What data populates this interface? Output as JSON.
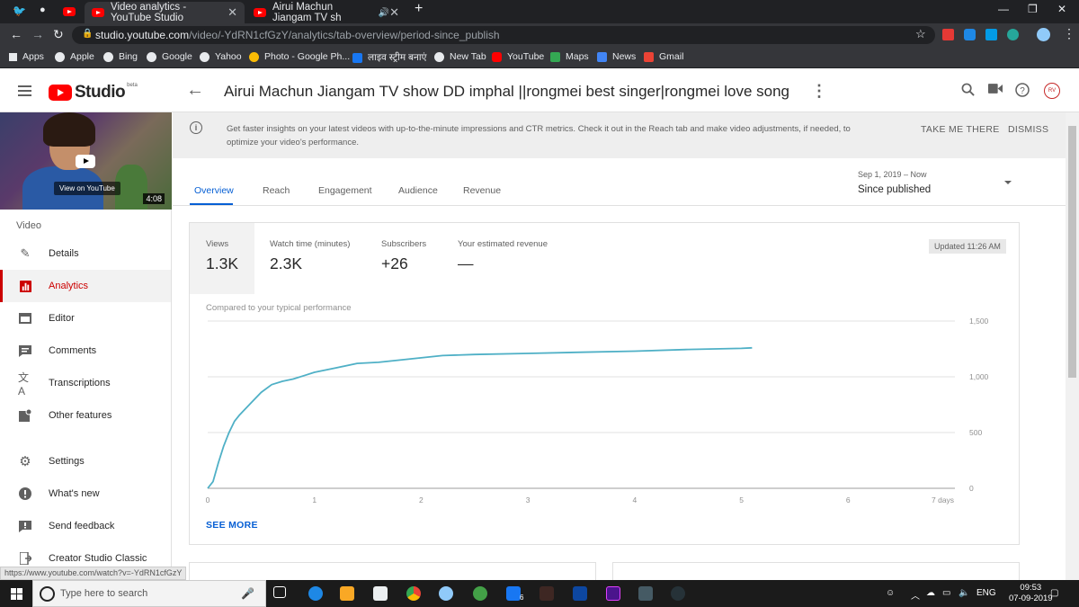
{
  "browser": {
    "tabs": [
      {
        "title": "Video analytics - YouTube Studio"
      },
      {
        "title": "Airui Machun Jiangam TV sh"
      }
    ],
    "url_host": "studio.youtube.com",
    "url_path": "/video/-YdRN1cfGzY/analytics/tab-overview/period-since_publish",
    "bookmarks": [
      "Apps",
      "Apple",
      "Bing",
      "Google",
      "Yahoo",
      "Photo - Google Ph...",
      "लाइव स्ट्रीम बनाएं",
      "New Tab",
      "YouTube",
      "Maps",
      "News",
      "Gmail"
    ],
    "status_url": "https://www.youtube.com/watch?v=-YdRN1cfGzY"
  },
  "header": {
    "logo_text": "Studio",
    "logo_beta": "beta",
    "video_title": "Airui Machun Jiangam TV show DD imphal ||rongmei best singer|rongmei love song",
    "avatar_initials": "RV"
  },
  "sidebar": {
    "thumbnail_overlay": "View on YouTube",
    "duration": "4:08",
    "section_label": "Video",
    "items": [
      {
        "label": "Details",
        "icon": "pencil-icon"
      },
      {
        "label": "Analytics",
        "icon": "analytics-icon"
      },
      {
        "label": "Editor",
        "icon": "film-icon"
      },
      {
        "label": "Comments",
        "icon": "comment-icon"
      },
      {
        "label": "Transcriptions",
        "icon": "translate-icon"
      },
      {
        "label": "Other features",
        "icon": "features-icon"
      },
      {
        "label": "Settings",
        "icon": "gear-icon"
      },
      {
        "label": "What's new",
        "icon": "whats-new-icon"
      },
      {
        "label": "Send feedback",
        "icon": "feedback-icon"
      },
      {
        "label": "Creator Studio Classic",
        "icon": "classic-icon"
      }
    ]
  },
  "banner": {
    "message": "Get faster insights on your latest videos with up-to-the-minute impressions and CTR metrics. Check it out in the Reach tab and make video adjustments, if needed, to optimize your video's performance.",
    "take_me_there": "TAKE ME THERE",
    "dismiss": "DISMISS"
  },
  "analytics_tabs": [
    "Overview",
    "Reach",
    "Engagement",
    "Audience",
    "Revenue"
  ],
  "period": {
    "range": "Sep 1, 2019 – Now",
    "label": "Since published"
  },
  "metrics": [
    {
      "label": "Views",
      "value": "1.3K"
    },
    {
      "label": "Watch time (minutes)",
      "value": "2.3K"
    },
    {
      "label": "Subscribers",
      "value": "+26"
    },
    {
      "label": "Your estimated revenue",
      "value": "—"
    }
  ],
  "updated": "Updated 11:26 AM",
  "compare_label": "Compared to your typical performance",
  "see_more": "SEE MORE",
  "chart_data": {
    "type": "line",
    "x_tick_labels": [
      "0",
      "1",
      "2",
      "3",
      "4",
      "5",
      "6",
      "7 days"
    ],
    "y_tick_labels": [
      "0",
      "500",
      "1,000",
      "1,500"
    ],
    "xlim": [
      0,
      7
    ],
    "ylim": [
      0,
      1500
    ],
    "grid": true,
    "color": "#4fb0c6",
    "series": [
      {
        "x": [
          0,
          0.05,
          0.1,
          0.15,
          0.2,
          0.25,
          0.3,
          0.4,
          0.5,
          0.6,
          0.7,
          0.8,
          0.9,
          1.0,
          1.2,
          1.4,
          1.6,
          1.8,
          2.0,
          2.2,
          2.5,
          3.0,
          3.5,
          4.0,
          4.5,
          5.0,
          5.1
        ],
        "y": [
          0,
          60,
          230,
          380,
          500,
          600,
          660,
          760,
          860,
          930,
          960,
          980,
          1010,
          1040,
          1080,
          1120,
          1130,
          1150,
          1170,
          1190,
          1200,
          1210,
          1220,
          1230,
          1245,
          1255,
          1260
        ]
      }
    ]
  },
  "taskbar": {
    "search_placeholder": "Type here to search",
    "badge": "6",
    "lang": "ENG",
    "time": "09:53",
    "date": "07-09-2019"
  }
}
